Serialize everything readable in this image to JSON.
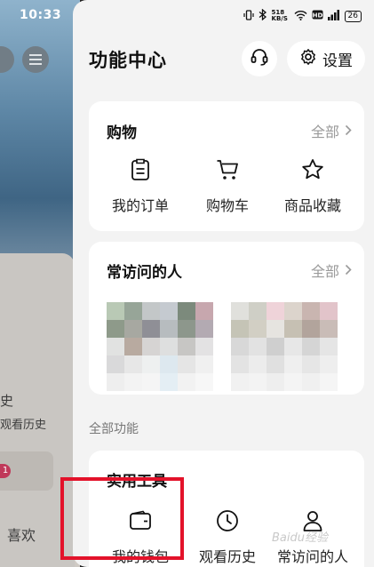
{
  "status_bar": {
    "time": "10:33",
    "net_speed": "518 KB/S",
    "battery": "26"
  },
  "background_app": {
    "partial_text_1": "史",
    "partial_text_2": "观看历史",
    "partial_badge": "1",
    "partial_text_3": "喜欢"
  },
  "header": {
    "title": "功能中心",
    "settings_label": "设置",
    "service_icon": "headset-icon",
    "settings_icon": "gear-icon"
  },
  "shopping": {
    "title": "购物",
    "more_label": "全部",
    "items": [
      {
        "label": "我的订单",
        "icon": "order-icon"
      },
      {
        "label": "购物车",
        "icon": "cart-icon"
      },
      {
        "label": "商品收藏",
        "icon": "star-icon"
      }
    ]
  },
  "frequent_people": {
    "title": "常访问的人",
    "more_label": "全部"
  },
  "all_functions": {
    "section_label": "全部功能",
    "card_title": "实用工具",
    "items": [
      {
        "label": "我的钱包",
        "icon": "wallet-icon"
      },
      {
        "label": "观看历史",
        "icon": "clock-icon"
      },
      {
        "label": "常访问的人",
        "icon": "person-icon"
      }
    ]
  },
  "watermark": "Baidu经验",
  "colors": {
    "highlight": "#e3122a",
    "panel_bg": "#f3f3f3",
    "card_bg": "#ffffff"
  }
}
